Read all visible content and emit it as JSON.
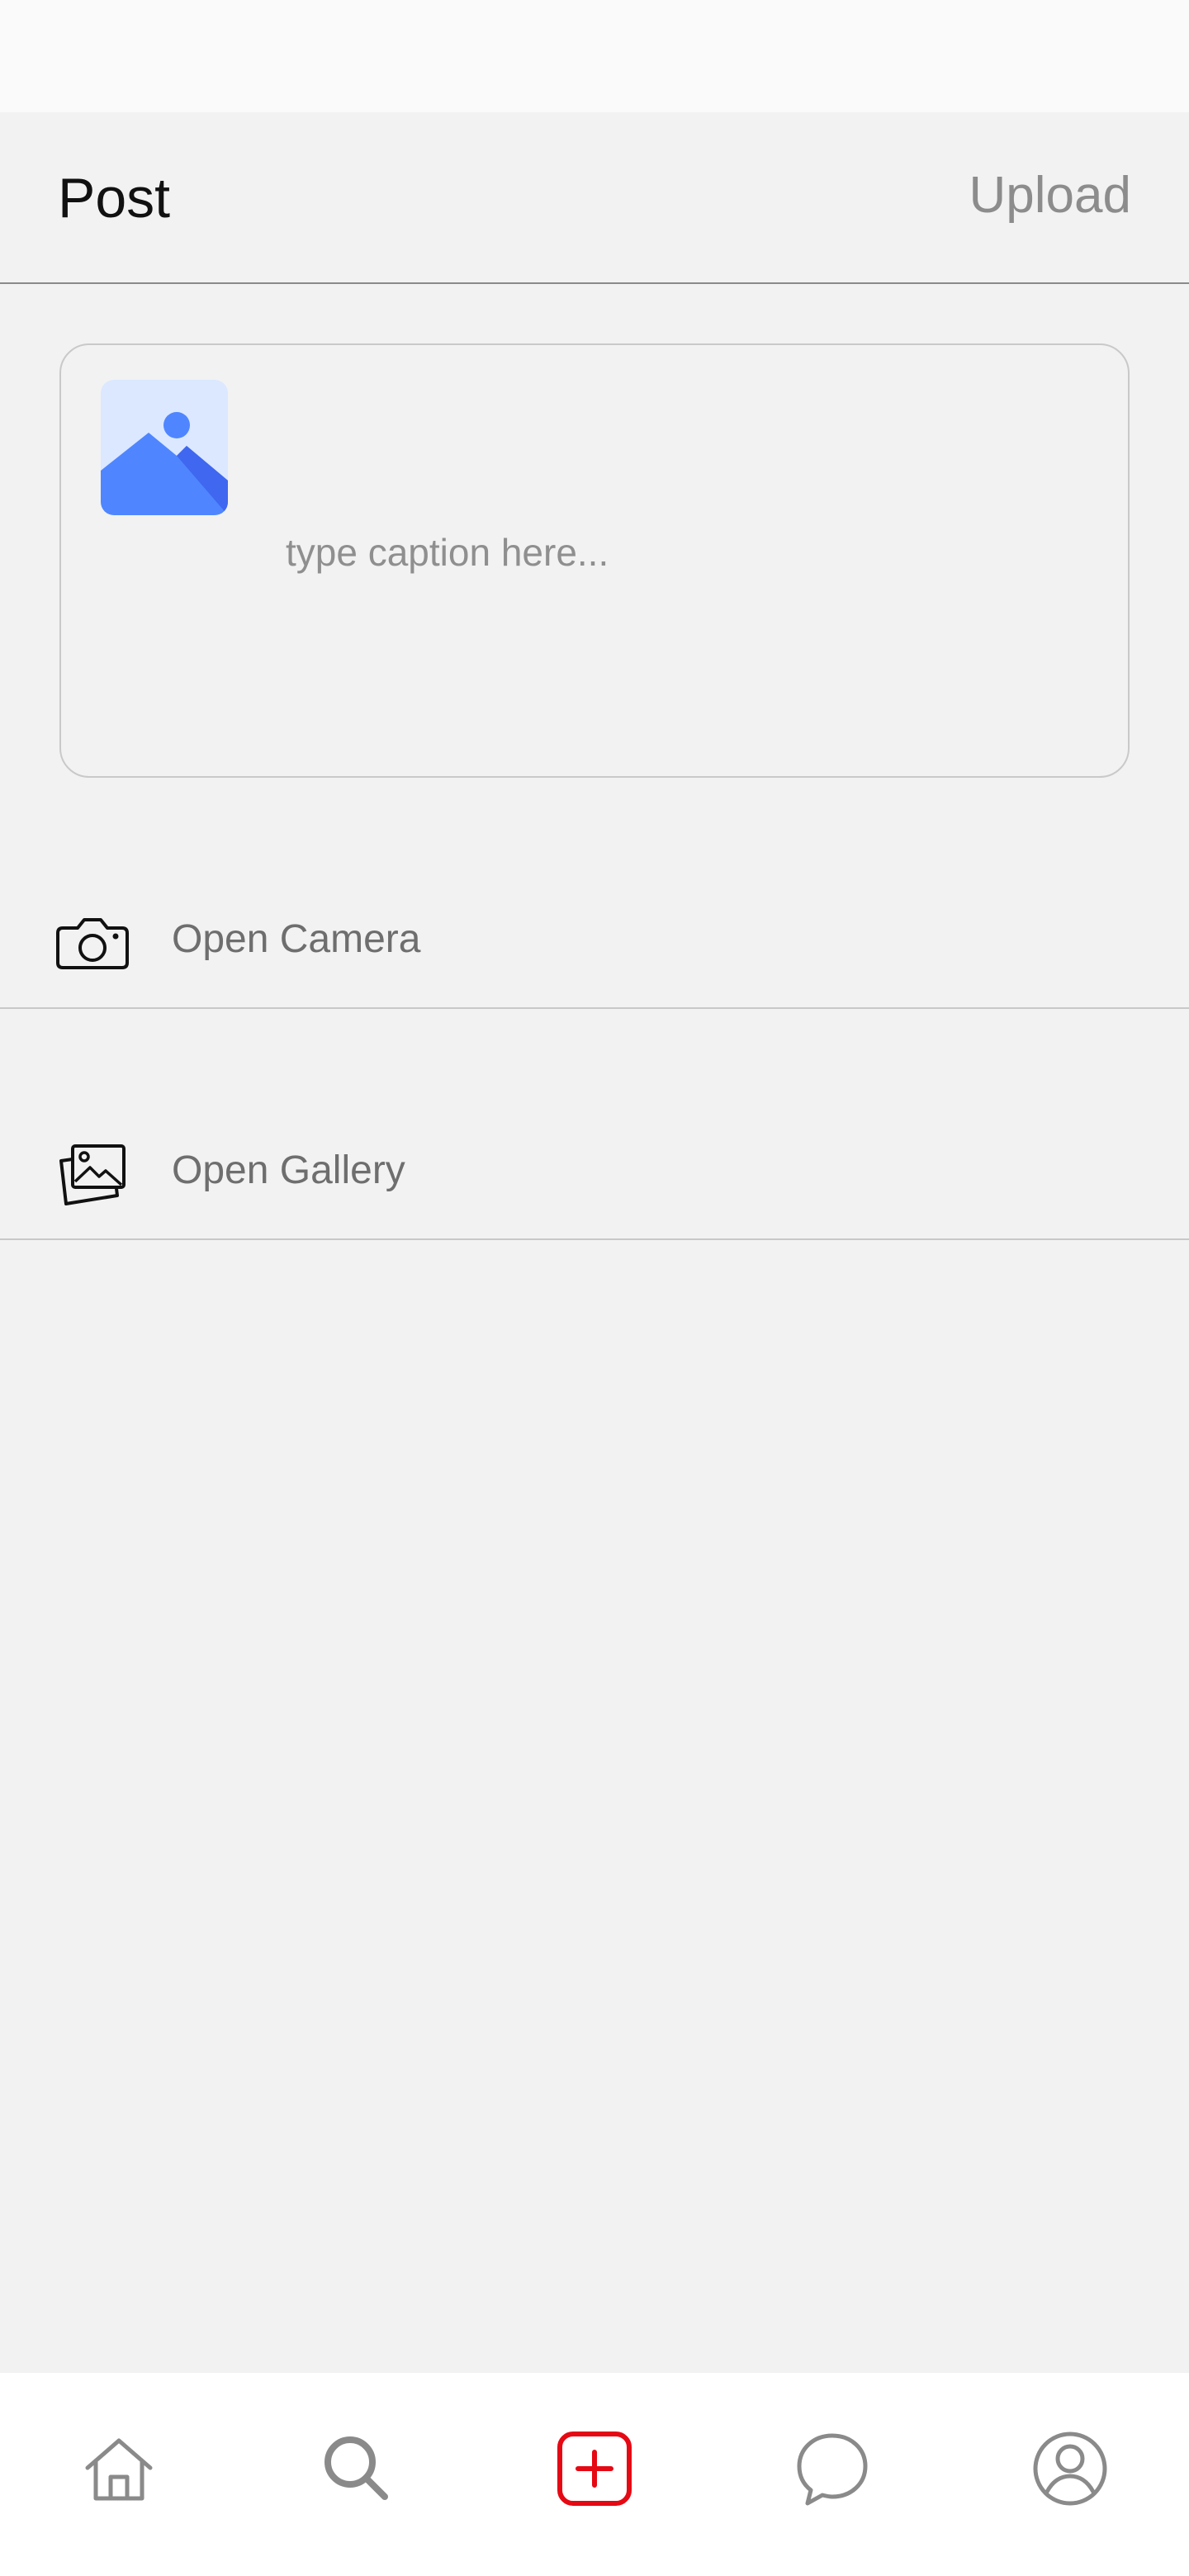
{
  "header": {
    "title": "Post",
    "upload_label": "Upload"
  },
  "composer": {
    "caption_placeholder": "type caption here...",
    "caption_value": "",
    "thumbnail_icon": "image-placeholder-icon"
  },
  "options": [
    {
      "label": "Open Camera",
      "icon": "camera-icon"
    },
    {
      "label": "Open Gallery",
      "icon": "gallery-icon"
    }
  ],
  "bottom_nav": {
    "items": [
      {
        "icon": "home-icon"
      },
      {
        "icon": "search-icon"
      },
      {
        "icon": "add-post-icon",
        "active": true
      },
      {
        "icon": "chat-icon"
      },
      {
        "icon": "profile-icon"
      }
    ]
  },
  "colors": {
    "background": "#f2f2f2",
    "accent": "#e50914",
    "thumbnail_blue": "#4d86ff",
    "thumbnail_light": "#dbe8ff",
    "muted_text": "#8c8c8c"
  }
}
